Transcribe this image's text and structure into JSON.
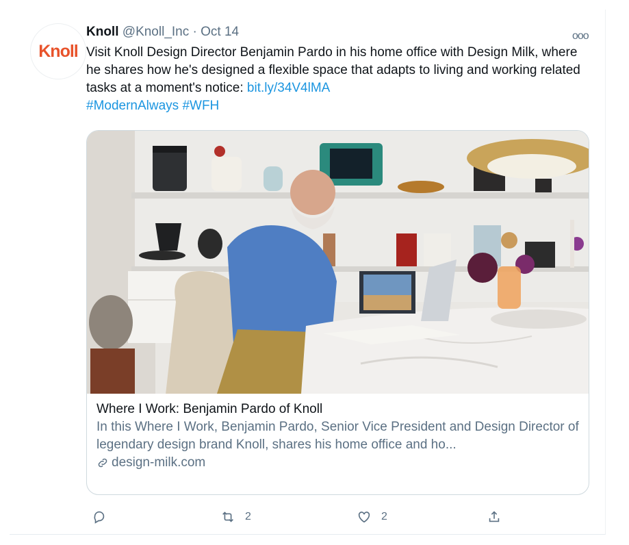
{
  "tweet": {
    "avatar_text": "Knoll",
    "name": "Knoll",
    "handle": "@Knoll_Inc",
    "separator": "·",
    "date": "Oct 14",
    "more_label": "ooo",
    "text_main": "Visit Knoll Design Director Benjamin Pardo in his home office with Design Milk, where he shares how he's designed a flexible space that adapts to living and working related tasks at a moment's notice: ",
    "link": "bit.ly/34V4lMA",
    "hashtag1": "#ModernAlways",
    "hashtag2": "#WFH"
  },
  "card": {
    "image_icon": "home-office-photo",
    "title": "Where I Work: Benjamin Pardo of Knoll",
    "description": "In this Where I Work, Benjamin Pardo, Senior Vice President and Design Director of legendary design brand Knoll, shares his home office and ho...",
    "domain_icon": "link-icon",
    "domain": "design-milk.com"
  },
  "actions": {
    "reply_count": "",
    "retweet_count": "2",
    "like_count": "2",
    "share_count": ""
  },
  "colors": {
    "link": "#1b95e0",
    "secondary": "#5b7083",
    "brand": "#e8532b"
  }
}
